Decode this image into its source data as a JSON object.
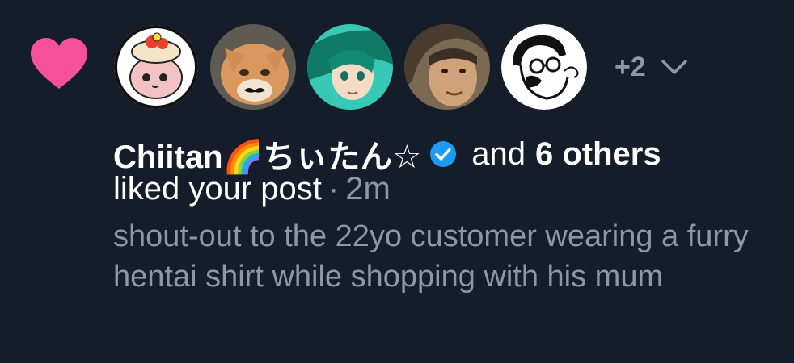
{
  "notification": {
    "icon": "heart-icon",
    "heart_color": "#f5509b",
    "avatars": [
      {
        "name": "avatar-user-1"
      },
      {
        "name": "avatar-user-2"
      },
      {
        "name": "avatar-user-3"
      },
      {
        "name": "avatar-user-4"
      },
      {
        "name": "avatar-user-5"
      }
    ],
    "more_count": "+2",
    "user_name": "Chiitan🌈ちぃたん☆",
    "verified_color": "#1d9bf0",
    "and_text": "and",
    "others_text": "6 others",
    "action": "liked your post",
    "separator": "·",
    "time": "2m",
    "post_text": "shout-out to the 22yo customer wearing a furry hentai shirt while shopping with his mum"
  }
}
